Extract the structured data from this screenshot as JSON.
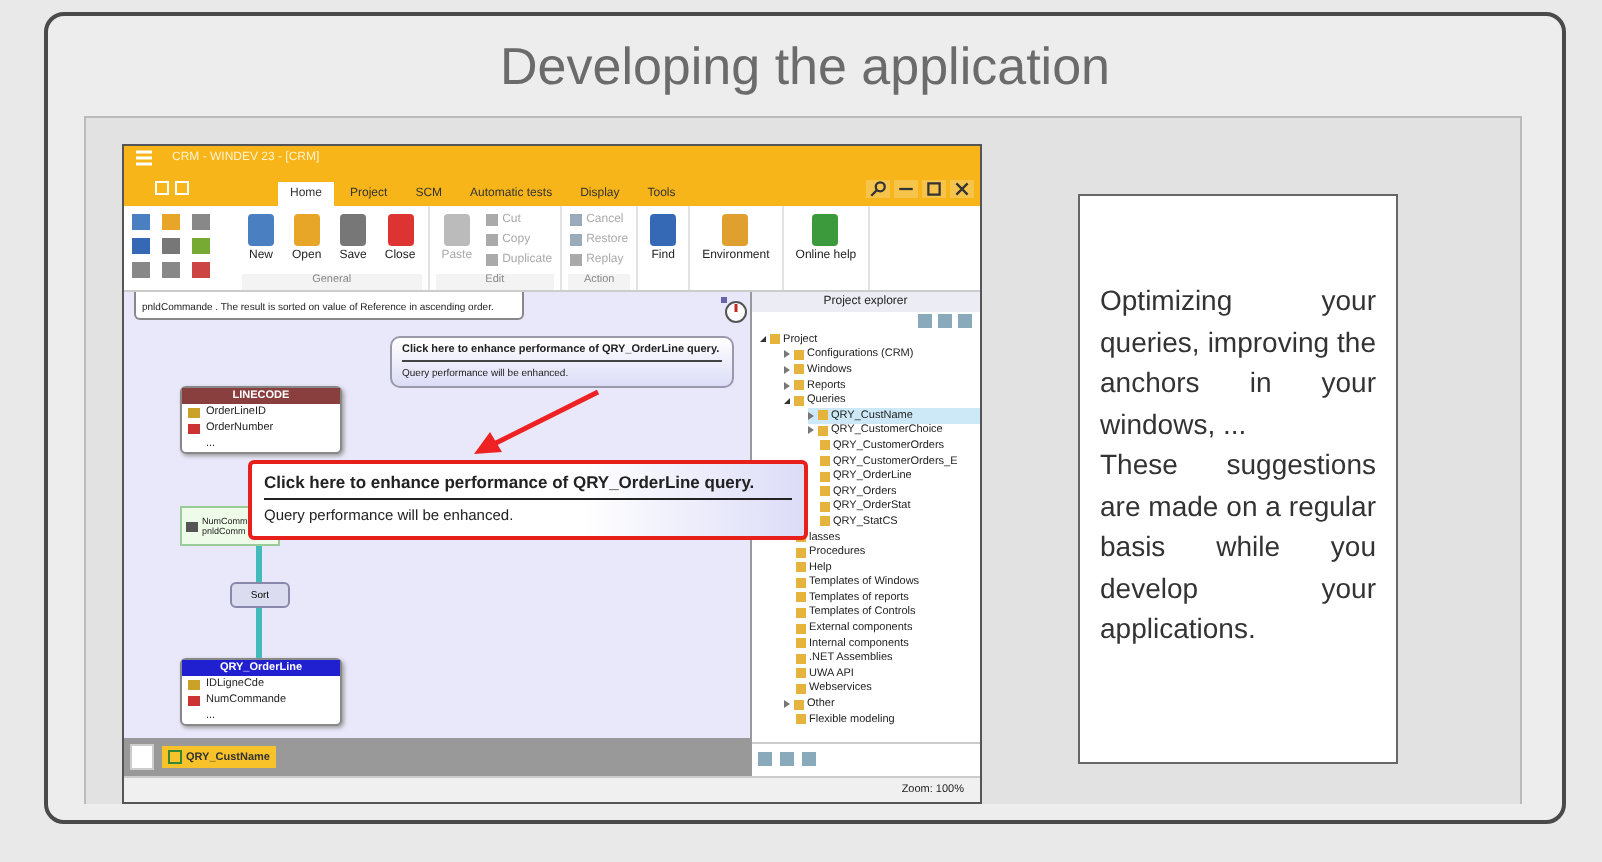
{
  "slide": {
    "title": "Developing the application"
  },
  "app": {
    "title": "CRM - WINDEV 23 - [CRM]",
    "tabs": [
      {
        "label": "Home",
        "selected": true
      },
      {
        "label": "Project",
        "selected": false
      },
      {
        "label": "SCM",
        "selected": false
      },
      {
        "label": "Automatic tests",
        "selected": false
      },
      {
        "label": "Display",
        "selected": false
      },
      {
        "label": "Tools",
        "selected": false
      }
    ],
    "ribbon": [
      {
        "group": "General",
        "buttons": [
          {
            "label": "New",
            "kind": "large",
            "disabled": false
          },
          {
            "label": "Open",
            "kind": "large",
            "disabled": false
          },
          {
            "label": "Save",
            "kind": "large",
            "disabled": false
          },
          {
            "label": "Close",
            "kind": "large",
            "disabled": false
          }
        ]
      },
      {
        "group": "Edit",
        "buttons": [
          {
            "label": "Paste",
            "kind": "large",
            "disabled": true
          },
          {
            "label": "Cut",
            "kind": "small",
            "disabled": true
          },
          {
            "label": "Copy",
            "kind": "small",
            "disabled": true
          },
          {
            "label": "Duplicate",
            "kind": "small",
            "disabled": true
          }
        ]
      },
      {
        "group": "Action",
        "buttons": [
          {
            "label": "Cancel",
            "kind": "small",
            "disabled": true
          },
          {
            "label": "Restore",
            "kind": "small",
            "disabled": true
          },
          {
            "label": "Replay",
            "kind": "small",
            "disabled": true
          }
        ]
      },
      {
        "buttons": [
          {
            "label": "Find",
            "kind": "large",
            "disabled": false
          }
        ]
      },
      {
        "buttons": [
          {
            "label": "Environment",
            "kind": "large",
            "disabled": false
          }
        ]
      },
      {
        "buttons": [
          {
            "label": "Online help",
            "kind": "large",
            "disabled": false
          }
        ]
      }
    ],
    "canvas": {
      "comment": "pnldCommande . The result is sorted on value of Reference in ascending order.",
      "tooltip": {
        "title": "Click here to enhance performance of QRY_OrderLine query.",
        "text": "Query performance will be enhanced."
      },
      "callout": {
        "title": "Click here to enhance performance of QRY_OrderLine query.",
        "text": "Query performance will be enhanced."
      },
      "tables": [
        {
          "name": "LINECODE",
          "kind": "file",
          "fields": [
            {
              "name": "OrderLineID",
              "kind": "key"
            },
            {
              "name": "OrderNumber",
              "kind": "number"
            },
            {
              "name": "...",
              "kind": "more"
            }
          ]
        },
        {
          "name": "QRY_OrderLine",
          "kind": "query",
          "fields": [
            {
              "name": "IDLigneCde",
              "kind": "key"
            },
            {
              "name": "NumCommande",
              "kind": "number"
            },
            {
              "name": "...",
              "kind": "more"
            }
          ]
        }
      ],
      "condition": [
        "NumComm",
        "pnldComm"
      ],
      "sort": "Sort"
    },
    "editor_tabs": [
      {
        "label": "QRY_CustName",
        "selected": true
      }
    ],
    "explorer": {
      "title": "Project explorer",
      "tree": [
        {
          "label": "Project",
          "expanded": true,
          "selected": false,
          "children": [
            {
              "label": "Configurations (CRM)",
              "expanded": false,
              "selected": false
            },
            {
              "label": "Windows",
              "expanded": false,
              "selected": false
            },
            {
              "label": "Reports",
              "expanded": false,
              "selected": false
            },
            {
              "label": "Queries",
              "expanded": true,
              "selected": false,
              "children": [
                {
                  "label": "QRY_CustName",
                  "expanded": false,
                  "selected": true
                },
                {
                  "label": "QRY_CustomerChoice",
                  "expanded": false,
                  "selected": false
                },
                {
                  "label": "QRY_CustomerOrders",
                  "selected": false
                },
                {
                  "label": "QRY_CustomerOrders_E",
                  "selected": false
                },
                {
                  "label": "QRY_OrderLine",
                  "selected": false
                },
                {
                  "label": "QRY_Orders",
                  "selected": false
                },
                {
                  "label": "QRY_OrderStat",
                  "selected": false
                },
                {
                  "label": "QRY_StatCS",
                  "selected": false
                }
              ]
            },
            {
              "label": "lasses",
              "selected": false
            },
            {
              "label": "Procedures",
              "selected": false
            },
            {
              "label": "Help",
              "selected": false
            },
            {
              "label": "Templates of Windows",
              "selected": false
            },
            {
              "label": "Templates of reports",
              "selected": false
            },
            {
              "label": "Templates of Controls",
              "selected": false
            },
            {
              "label": "External components",
              "selected": false
            },
            {
              "label": "Internal components",
              "selected": false
            },
            {
              "label": ".NET Assemblies",
              "selected": false
            },
            {
              "label": "UWA API",
              "selected": false
            },
            {
              "label": "Webservices",
              "selected": false
            },
            {
              "label": "Other",
              "expanded": false,
              "selected": false
            },
            {
              "label": "Flexible modeling",
              "selected": false
            }
          ]
        }
      ]
    },
    "status": "Zoom: 100%"
  },
  "notes": [
    "Optimizing your queries, improving the anchors in your windows, ...",
    "These suggestions are made on a regular basis while you develop your applications."
  ]
}
